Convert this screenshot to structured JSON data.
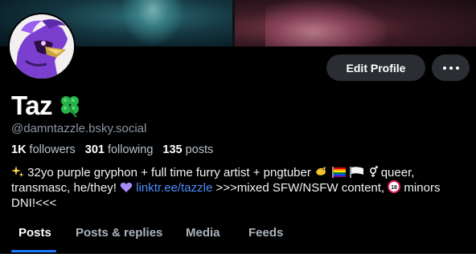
{
  "profile": {
    "display_name": "Taz",
    "handle": "@damntazzle.bsky.social",
    "stats": {
      "followers_count": "1K",
      "followers_label": "followers",
      "following_count": "301",
      "following_label": "following",
      "posts_count": "135",
      "posts_label": "posts"
    },
    "bio": {
      "part1": " 32yo purple gryphon + full time furry artist + pngtuber ",
      "part2": " queer,",
      "line2_start": "transmasc, he/they! ",
      "link": "linktr.ee/tazzle",
      "line2_rest": " >>>mixed SFW/NSFW content, ",
      "line2_end": " minors",
      "line3": "DNI!<<<"
    }
  },
  "actions": {
    "edit_profile_label": "Edit Profile"
  },
  "tabs": [
    {
      "label": "Posts"
    },
    {
      "label": "Posts & replies"
    },
    {
      "label": "Media"
    },
    {
      "label": "Feeds"
    }
  ],
  "colors": {
    "background": "#000000",
    "button_bg": "#2a2d31",
    "link": "#4c8dff",
    "active_tab_underline": "#1f7bff",
    "secondary_text": "#8d96a2"
  }
}
